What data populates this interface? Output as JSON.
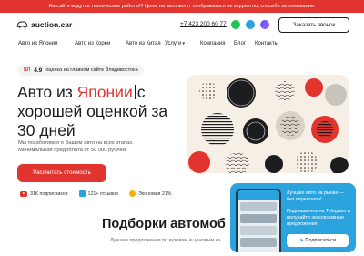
{
  "banner": {
    "text": "На сайте ведутся технические работы!!! Цены на авто могут отображаться не корректно, спасибо за понимание."
  },
  "header": {
    "logo_text": "auction.car",
    "phone": "+7 423 200 60 77",
    "order_call_label": "Заказать звонок"
  },
  "nav": {
    "items": [
      {
        "label": "Авто из Японии"
      },
      {
        "label": "Авто из Кореи"
      },
      {
        "label": "Авто из Китая"
      },
      {
        "label": "Услуги"
      },
      {
        "label": "Компания"
      },
      {
        "label": "Блог"
      },
      {
        "label": "Контакты"
      }
    ]
  },
  "rating": {
    "source": "ВЛ",
    "score": "4.9",
    "text": "оценка на главном сайте Владивостока"
  },
  "hero": {
    "title_part1": "Авто из ",
    "title_accent": "Японии",
    "title_part2": "с хорошей оценкой за 30 дней",
    "subtitle": "Мы позаботимся о Вашем авто на всех этапах. Минимальная предоплата от 50 000 рублей.",
    "cta_label": "Рассчитать стоимость"
  },
  "stats": {
    "youtube": "31К подписчиков",
    "reviews": "121+ отзывов",
    "economy": "Экономия 21%"
  },
  "section": {
    "title": "Подборки автомоб",
    "subtitle": "Лучшие предложения по кузовам и ценовым ка"
  },
  "telegram_popup": {
    "text1": "Лучшие авто на рынке — без переплаты!",
    "text2": "Подпишитесь на Telegram и получайте эксклюзивные предложения!",
    "button_label": "Подписаться"
  },
  "colors": {
    "accent": "#e2342f",
    "telegram": "#2aa3df"
  }
}
